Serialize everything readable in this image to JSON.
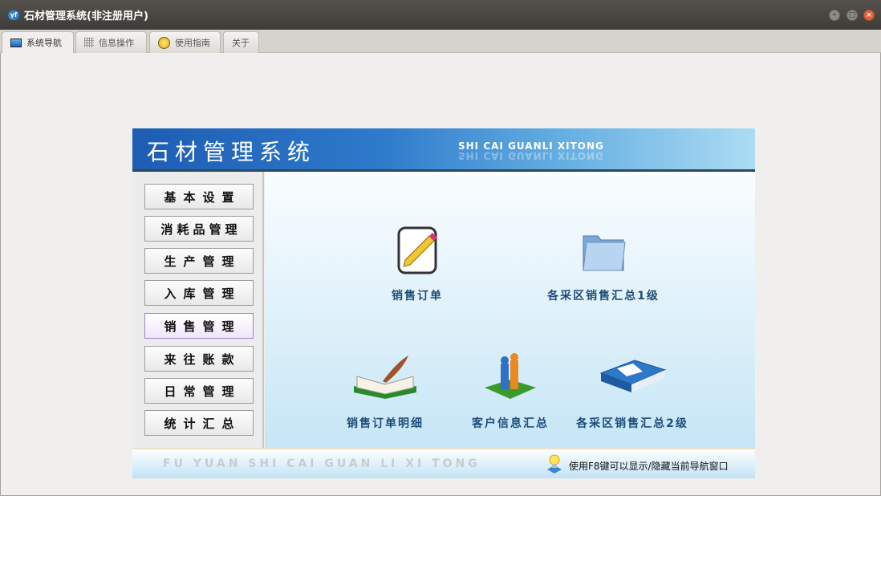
{
  "window": {
    "title": "石材管理系统(非注册用户)",
    "app_icon": "yf",
    "controls": [
      "minimize",
      "maximize",
      "close"
    ]
  },
  "tabs": [
    {
      "label": "系统导航",
      "icon": "monitor-icon",
      "active": true
    },
    {
      "label": "信息操作",
      "icon": "grid-icon"
    },
    {
      "label": "使用指南",
      "icon": "help-icon"
    },
    {
      "label": "关于"
    }
  ],
  "header": {
    "title": "石材管理系统",
    "subtitle": "SHI CAI GUANLI XITONG"
  },
  "sidebar": {
    "items": [
      {
        "label": "基本设置"
      },
      {
        "label": "消耗品管理"
      },
      {
        "label": "生产管理"
      },
      {
        "label": "入库管理"
      },
      {
        "label": "销售管理",
        "selected": true
      },
      {
        "label": "来往账款"
      },
      {
        "label": "日常管理"
      },
      {
        "label": "统计汇总"
      }
    ]
  },
  "main": {
    "items": [
      {
        "label": "销售订单",
        "icon": "edit-document-icon"
      },
      {
        "label": "各采区销售汇总1级",
        "icon": "folder-icon"
      },
      {
        "label": "销售订单明细",
        "icon": "book-quill-icon"
      },
      {
        "label": "客户信息汇总",
        "icon": "customers-icon"
      },
      {
        "label": "各采区销售汇总2级",
        "icon": "books-icon"
      }
    ]
  },
  "footer": {
    "brand": "FU YUAN SHI CAI GUAN LI XI TONG",
    "hint": "使用F8键可以显示/隐藏当前导航窗口"
  }
}
